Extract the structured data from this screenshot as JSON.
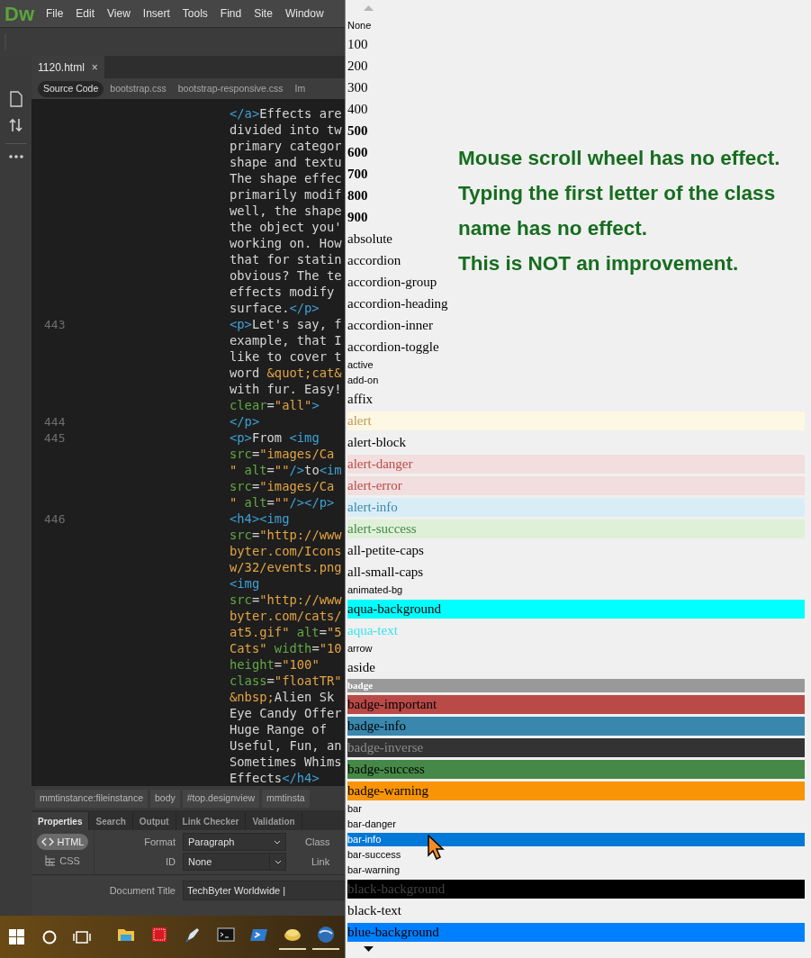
{
  "menu_bar": {
    "logo": "Dw",
    "items": [
      "File",
      "Edit",
      "View",
      "Insert",
      "Tools",
      "Find",
      "Site",
      "Window"
    ]
  },
  "document_tabs": [
    {
      "label": "1120.html",
      "close": "×",
      "selected": true
    }
  ],
  "related_files": [
    {
      "label": "Source Code",
      "selected": true
    },
    {
      "label": "bootstrap.css",
      "selected": false
    },
    {
      "label": "bootstrap-responsive.css",
      "selected": false
    },
    {
      "label": "Im",
      "selected": false
    }
  ],
  "code": {
    "lines": [
      {
        "segments": [
          {
            "kind": "tag",
            "text": "</a>"
          },
          {
            "kind": "text",
            "text": "Effects are"
          }
        ]
      },
      {
        "segments": [
          {
            "kind": "text",
            "text": "divided into tw"
          }
        ]
      },
      {
        "segments": [
          {
            "kind": "text",
            "text": "primary categor"
          }
        ]
      },
      {
        "segments": [
          {
            "kind": "text",
            "text": "shape and textu"
          }
        ]
      },
      {
        "segments": [
          {
            "kind": "text",
            "text": "The shape effec"
          }
        ]
      },
      {
        "segments": [
          {
            "kind": "text",
            "text": "primarily modif"
          }
        ]
      },
      {
        "segments": [
          {
            "kind": "text",
            "text": "well, the shape"
          }
        ]
      },
      {
        "segments": [
          {
            "kind": "text",
            "text": "the object you'"
          }
        ]
      },
      {
        "segments": [
          {
            "kind": "text",
            "text": "working on. How"
          }
        ]
      },
      {
        "segments": [
          {
            "kind": "text",
            "text": "that for statin"
          }
        ]
      },
      {
        "segments": [
          {
            "kind": "text",
            "text": "obvious? The te"
          }
        ]
      },
      {
        "segments": [
          {
            "kind": "text",
            "text": "effects modify"
          }
        ]
      },
      {
        "segments": [
          {
            "kind": "text",
            "text": "surface."
          },
          {
            "kind": "tag",
            "text": "</p>"
          }
        ]
      },
      {
        "number": "443",
        "segments": [
          {
            "kind": "tag",
            "text": "<p>"
          },
          {
            "kind": "text",
            "text": "Let's say, f"
          }
        ]
      },
      {
        "segments": [
          {
            "kind": "text",
            "text": "example, that I"
          }
        ]
      },
      {
        "segments": [
          {
            "kind": "text",
            "text": "like to cover t"
          }
        ]
      },
      {
        "segments": [
          {
            "kind": "text",
            "text": "word "
          },
          {
            "kind": "string",
            "text": "&quot;cat&"
          }
        ]
      },
      {
        "segments": [
          {
            "kind": "text",
            "text": "with fur. Easy!"
          }
        ]
      },
      {
        "segments": [
          {
            "kind": "attr",
            "text": "clear"
          },
          {
            "kind": "text",
            "text": "="
          },
          {
            "kind": "string",
            "text": "\"all\""
          },
          {
            "kind": "tag",
            "text": ">"
          }
        ]
      },
      {
        "number": "444",
        "segments": [
          {
            "kind": "tag",
            "text": "</p>"
          }
        ]
      },
      {
        "number": "445",
        "segments": [
          {
            "kind": "tag",
            "text": "<p>"
          },
          {
            "kind": "text",
            "text": "From "
          },
          {
            "kind": "tag",
            "text": "<img"
          }
        ]
      },
      {
        "segments": [
          {
            "kind": "attr",
            "text": "src"
          },
          {
            "kind": "text",
            "text": "="
          },
          {
            "kind": "string",
            "text": "\"images/Ca"
          }
        ]
      },
      {
        "segments": [
          {
            "kind": "string",
            "text": "\""
          },
          {
            "kind": "attr",
            "text": " alt"
          },
          {
            "kind": "text",
            "text": "="
          },
          {
            "kind": "string",
            "text": "\"\""
          },
          {
            "kind": "tag",
            "text": "/>"
          },
          {
            "kind": "text",
            "text": "to"
          },
          {
            "kind": "tag",
            "text": "<im"
          }
        ]
      },
      {
        "segments": [
          {
            "kind": "attr",
            "text": "src"
          },
          {
            "kind": "text",
            "text": "="
          },
          {
            "kind": "string",
            "text": "\"images/Ca"
          }
        ]
      },
      {
        "segments": [
          {
            "kind": "string",
            "text": "\""
          },
          {
            "kind": "attr",
            "text": " alt"
          },
          {
            "kind": "text",
            "text": "="
          },
          {
            "kind": "string",
            "text": "\"\""
          },
          {
            "kind": "tag",
            "text": "/></p>"
          }
        ]
      },
      {
        "number": "446",
        "segments": [
          {
            "kind": "tag",
            "text": "<h4><img"
          }
        ]
      },
      {
        "segments": [
          {
            "kind": "attr",
            "text": "src"
          },
          {
            "kind": "text",
            "text": "="
          },
          {
            "kind": "string",
            "text": "\"http://www"
          }
        ]
      },
      {
        "segments": [
          {
            "kind": "string",
            "text": "byter.com/Icons"
          }
        ]
      },
      {
        "segments": [
          {
            "kind": "string",
            "text": "w/32/events.png"
          }
        ]
      },
      {
        "segments": [
          {
            "kind": "tag",
            "text": "<img"
          }
        ]
      },
      {
        "segments": [
          {
            "kind": "attr",
            "text": "src"
          },
          {
            "kind": "text",
            "text": "="
          },
          {
            "kind": "string",
            "text": "\"http://www"
          }
        ]
      },
      {
        "segments": [
          {
            "kind": "string",
            "text": "byter.com/cats/"
          }
        ]
      },
      {
        "segments": [
          {
            "kind": "string",
            "text": "at5.gif\""
          },
          {
            "kind": "attr",
            "text": " alt"
          },
          {
            "kind": "text",
            "text": "="
          },
          {
            "kind": "string",
            "text": "\"5"
          }
        ]
      },
      {
        "segments": [
          {
            "kind": "string",
            "text": "Cats\""
          },
          {
            "kind": "attr",
            "text": " width"
          },
          {
            "kind": "text",
            "text": "="
          },
          {
            "kind": "string",
            "text": "\"10"
          }
        ]
      },
      {
        "segments": [
          {
            "kind": "attr",
            "text": "height"
          },
          {
            "kind": "text",
            "text": "="
          },
          {
            "kind": "string",
            "text": "\"100\""
          }
        ]
      },
      {
        "segments": [
          {
            "kind": "attr",
            "text": "class"
          },
          {
            "kind": "text",
            "text": "="
          },
          {
            "kind": "string",
            "text": "\"floatTR\""
          }
        ]
      },
      {
        "segments": [
          {
            "kind": "string",
            "text": "&nbsp;"
          },
          {
            "kind": "text",
            "text": "Alien Sk"
          }
        ]
      },
      {
        "segments": [
          {
            "kind": "text",
            "text": "Eye Candy Offer"
          }
        ]
      },
      {
        "segments": [
          {
            "kind": "text",
            "text": "Huge Range of"
          }
        ]
      },
      {
        "segments": [
          {
            "kind": "text",
            "text": "Useful, Fun, an"
          }
        ]
      },
      {
        "segments": [
          {
            "kind": "text",
            "text": "Sometimes Whims"
          }
        ]
      },
      {
        "segments": [
          {
            "kind": "text",
            "text": "Effects"
          },
          {
            "kind": "tag",
            "text": "</h4>"
          }
        ]
      }
    ]
  },
  "breadcrumbs": [
    "mmtinstance:fileinstance",
    "body",
    "#top.designview",
    "mmtinsta"
  ],
  "panel_tabs": [
    {
      "label": "Properties",
      "selected": true
    },
    {
      "label": "Search",
      "selected": false
    },
    {
      "label": "Output",
      "selected": false
    },
    {
      "label": "Link Checker",
      "selected": false
    },
    {
      "label": "Validation",
      "selected": false
    }
  ],
  "properties": {
    "modes": [
      {
        "label": "HTML",
        "kind": "html",
        "selected": true
      },
      {
        "label": "CSS",
        "kind": "css",
        "selected": false
      }
    ],
    "format": {
      "label": "Format",
      "value": "Paragraph"
    },
    "id": {
      "label": "ID",
      "value": "None"
    },
    "class_label": "Class",
    "link_label": "Link",
    "document_title": {
      "label": "Document Title",
      "value": "TechByter Worldwide |"
    }
  },
  "class_dropdown": {
    "items": [
      {
        "label": "None",
        "kind": "sans",
        "selected": false
      },
      {
        "label": "100",
        "kind": "serif",
        "selected": false
      },
      {
        "label": "200",
        "kind": "serif",
        "selected": false
      },
      {
        "label": "300",
        "kind": "serif",
        "selected": false
      },
      {
        "label": "400",
        "kind": "serif",
        "selected": false
      },
      {
        "label": "500",
        "kind": "bold",
        "selected": false
      },
      {
        "label": "600",
        "kind": "bold",
        "selected": false
      },
      {
        "label": "700",
        "kind": "bold",
        "selected": false
      },
      {
        "label": "800",
        "kind": "bold",
        "selected": false
      },
      {
        "label": "900",
        "kind": "bold",
        "selected": false
      },
      {
        "label": "absolute",
        "kind": "serif",
        "selected": false
      },
      {
        "label": "accordion",
        "kind": "serif",
        "selected": false
      },
      {
        "label": "accordion-group",
        "kind": "serif",
        "selected": false
      },
      {
        "label": "accordion-heading",
        "kind": "serif",
        "selected": false
      },
      {
        "label": "accordion-inner",
        "kind": "serif",
        "selected": false
      },
      {
        "label": "accordion-toggle",
        "kind": "serif",
        "selected": false
      },
      {
        "label": "active",
        "kind": "sans",
        "selected": false
      },
      {
        "label": "add-on",
        "kind": "sans",
        "selected": false
      },
      {
        "label": "affix",
        "kind": "serif",
        "selected": false
      },
      {
        "label": "alert",
        "kind": "alert",
        "selected": false
      },
      {
        "label": "alert-block",
        "kind": "serif",
        "selected": false
      },
      {
        "label": "alert-danger",
        "kind": "alert-danger",
        "selected": false
      },
      {
        "label": "alert-error",
        "kind": "alert-danger",
        "selected": false
      },
      {
        "label": "alert-info",
        "kind": "alert-info",
        "selected": false
      },
      {
        "label": "alert-success",
        "kind": "alert-success",
        "selected": false
      },
      {
        "label": "all-petite-caps",
        "kind": "serif",
        "selected": false
      },
      {
        "label": "all-small-caps",
        "kind": "serif",
        "selected": false
      },
      {
        "label": "animated-bg",
        "kind": "sans",
        "selected": false
      },
      {
        "label": "aqua-background",
        "kind": "aqua-background",
        "selected": false
      },
      {
        "label": "aqua-text",
        "kind": "aqua-text",
        "selected": false
      },
      {
        "label": "arrow",
        "kind": "sans",
        "selected": false
      },
      {
        "label": "aside",
        "kind": "serif",
        "selected": false
      },
      {
        "label": "badge",
        "kind": "badge",
        "selected": false
      },
      {
        "label": "badge-important",
        "kind": "badge-important",
        "selected": false
      },
      {
        "label": "badge-info",
        "kind": "badge-info",
        "selected": false
      },
      {
        "label": "badge-inverse",
        "kind": "badge-inverse",
        "selected": false
      },
      {
        "label": "badge-success",
        "kind": "badge-success",
        "selected": false
      },
      {
        "label": "badge-warning",
        "kind": "badge-warning",
        "selected": false
      },
      {
        "label": "bar",
        "kind": "sans",
        "selected": false
      },
      {
        "label": "bar-danger",
        "kind": "sans",
        "selected": false
      },
      {
        "label": "bar-info",
        "kind": "sans",
        "selected": true
      },
      {
        "label": "bar-success",
        "kind": "sans",
        "selected": false
      },
      {
        "label": "bar-warning",
        "kind": "sans",
        "selected": false
      },
      {
        "label": "black-background",
        "kind": "black-background",
        "selected": false
      },
      {
        "label": "black-text",
        "kind": "serif",
        "selected": false
      },
      {
        "label": "blue-background",
        "kind": "blue-background",
        "selected": false
      }
    ]
  },
  "annotation": [
    "Mouse scroll wheel has no effect.",
    "Typing the first letter of the class name has no effect.",
    "This is NOT an improvement."
  ]
}
